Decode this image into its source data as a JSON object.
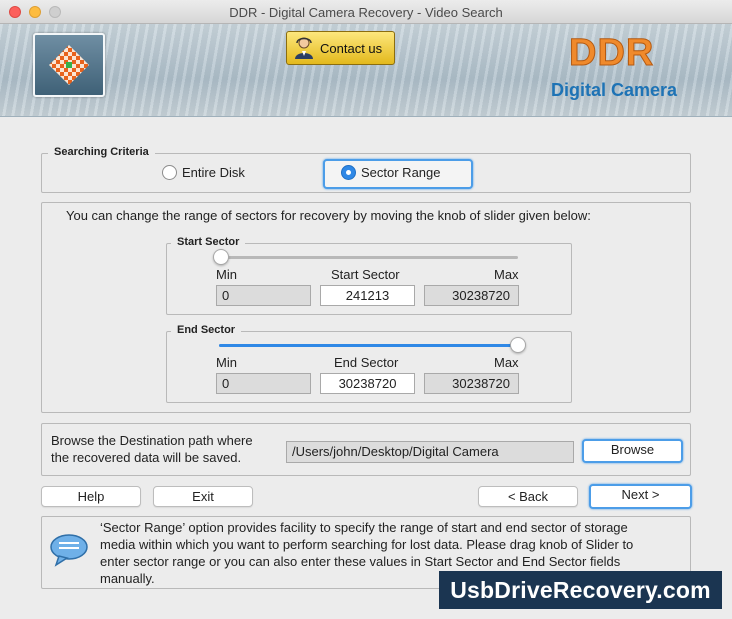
{
  "window": {
    "title": "DDR - Digital Camera Recovery - Video Search"
  },
  "banner": {
    "contact_label": "Contact us",
    "brand": "DDR",
    "brand_sub": "Digital Camera",
    "colors": {
      "brand": "#f08a2c",
      "brand_sub": "#1e73b5",
      "contact": "#f4cc3a"
    }
  },
  "criteria": {
    "legend": "Searching Criteria",
    "options": [
      {
        "label": "Entire Disk",
        "selected": false
      },
      {
        "label": "Sector Range",
        "selected": true
      }
    ]
  },
  "range": {
    "instruction": "You can change the range of sectors for recovery by moving the knob of slider given below:",
    "start": {
      "legend": "Start Sector",
      "min_label": "Min",
      "value_label": "Start Sector",
      "max_label": "Max",
      "min": "0",
      "value": "241213",
      "max": "30238720",
      "slider_fraction": 0.008
    },
    "end": {
      "legend": "End Sector",
      "min_label": "Min",
      "value_label": "End Sector",
      "max_label": "Max",
      "min": "0",
      "value": "30238720",
      "max": "30238720",
      "slider_fraction": 1.0
    }
  },
  "destination": {
    "label_line1": "Browse the Destination path where",
    "label_line2": "the recovered data will be saved.",
    "path": "/Users/john/Desktop/Digital Camera",
    "browse_label": "Browse"
  },
  "buttons": {
    "help": "Help",
    "exit": "Exit",
    "back": "< Back",
    "next": "Next >"
  },
  "info": {
    "lines": [
      "‘Sector Range’ option provides facility to specify the range of start and end sector of storage",
      "media within which you want to perform searching for lost data. Please drag knob of Slider to",
      "enter sector range or you can also enter these values in Start Sector and End Sector fields",
      "manually."
    ]
  },
  "watermark": "UsbDriveRecovery.com"
}
